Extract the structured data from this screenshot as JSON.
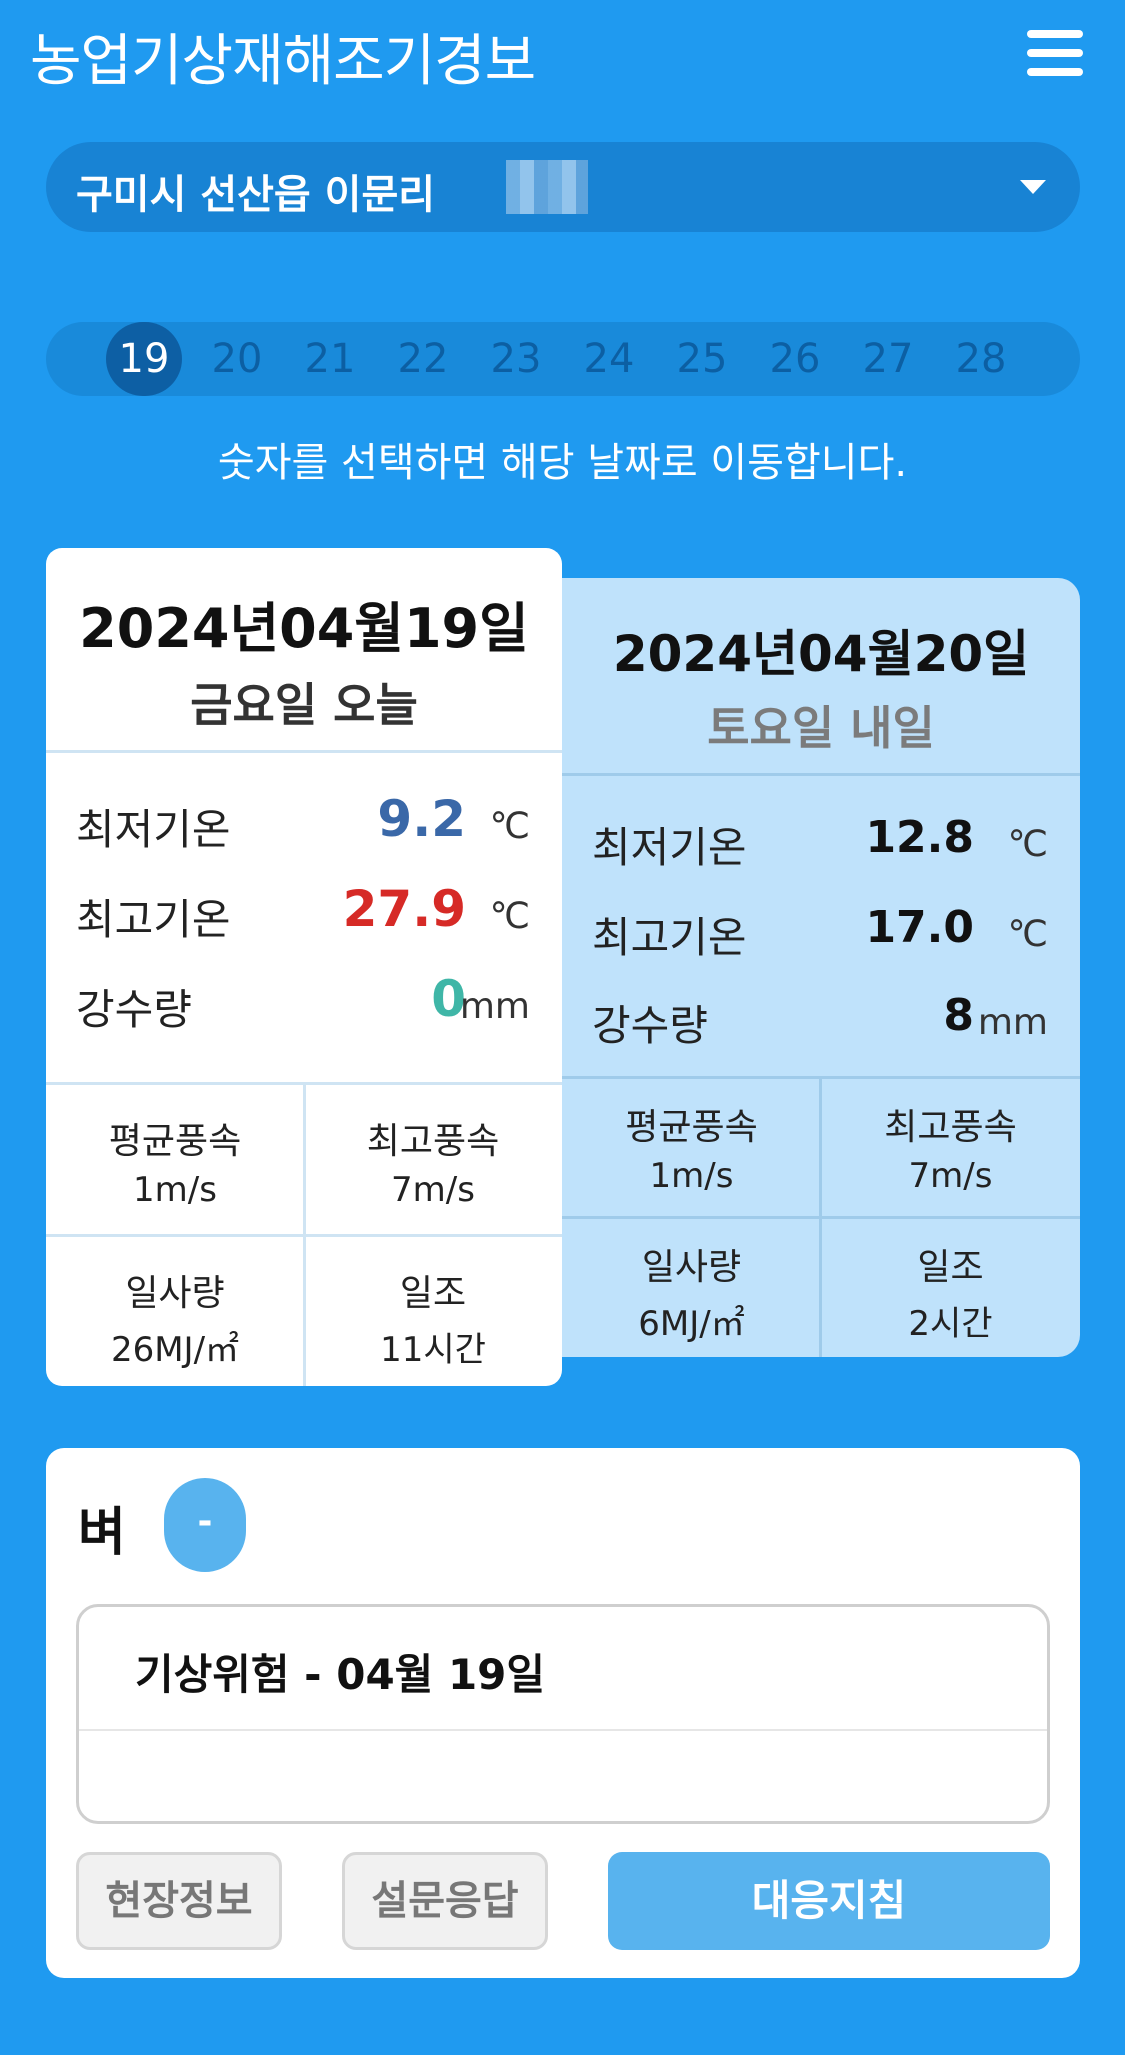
{
  "header": {
    "title": "농업기상재해조기경보",
    "menu_icon": "hamburger-menu-icon"
  },
  "location": {
    "text": "구미시 선산읍 이문리",
    "caret_icon": "caret-down-icon"
  },
  "dates": {
    "items": [
      "19",
      "20",
      "21",
      "22",
      "23",
      "24",
      "25",
      "26",
      "27",
      "28"
    ],
    "selected": "19",
    "hint": "숫자를 선택하면 해당 날짜로 이동합니다."
  },
  "today": {
    "date": "2024년04월19일",
    "day": "금요일 오늘",
    "min_temp": {
      "label": "최저기온",
      "value": "9.2",
      "unit": "℃",
      "color": "#3a68a8"
    },
    "max_temp": {
      "label": "최고기온",
      "value": "27.9",
      "unit": "℃",
      "color": "#d62a26"
    },
    "rain": {
      "label": "강수량",
      "value": "0",
      "unit": "mm",
      "color": "#3fb6a7"
    },
    "avg_wind": {
      "label": "평균풍속",
      "value": "1m/s"
    },
    "max_wind": {
      "label": "최고풍속",
      "value": "7m/s"
    },
    "radiation": {
      "label": "일사량",
      "value": "26MJ/㎡"
    },
    "sunshine": {
      "label": "일조",
      "value": "11시간"
    }
  },
  "tomorrow": {
    "date": "2024년04월20일",
    "day": "토요일 내일",
    "min_temp": {
      "label": "최저기온",
      "value": "12.8",
      "unit": "℃"
    },
    "max_temp": {
      "label": "최고기온",
      "value": "17.0",
      "unit": "℃"
    },
    "rain": {
      "label": "강수량",
      "value": "8",
      "unit": "mm"
    },
    "avg_wind": {
      "label": "평균풍속",
      "value": "1m/s"
    },
    "max_wind": {
      "label": "최고풍속",
      "value": "7m/s"
    },
    "radiation": {
      "label": "일사량",
      "value": "6MJ/㎡"
    },
    "sunshine": {
      "label": "일조",
      "value": "2시간"
    }
  },
  "crop": {
    "name": "벼",
    "badge": "-",
    "risk_title": "기상위험 - 04월 19일",
    "buttons": {
      "field_info": "현장정보",
      "survey": "설문응답",
      "guide": "대응지침"
    }
  },
  "colors": {
    "background": "#1f9af0",
    "accent_button": "#58b3ee",
    "tomorrow_card": "#bfe2fb"
  }
}
